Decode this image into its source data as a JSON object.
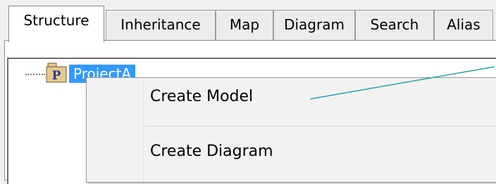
{
  "tabs": [
    {
      "label": "Structure",
      "active": true
    },
    {
      "label": "Inheritance",
      "active": false
    },
    {
      "label": "Map",
      "active": false
    },
    {
      "label": "Diagram",
      "active": false
    },
    {
      "label": "Search",
      "active": false
    },
    {
      "label": "Alias",
      "active": false
    }
  ],
  "tree": {
    "root": {
      "icon": "project-package-icon",
      "icon_letter": "P",
      "label": "ProjectA"
    }
  },
  "context_menu": {
    "items": [
      {
        "label": "Create Model"
      },
      {
        "label": "Create Diagram"
      }
    ]
  },
  "colors": {
    "selection": "#3399ff",
    "callout": "#2aa1a8",
    "package_icon_fill": "#e8c890",
    "package_icon_letter": "#2a3a8a"
  }
}
